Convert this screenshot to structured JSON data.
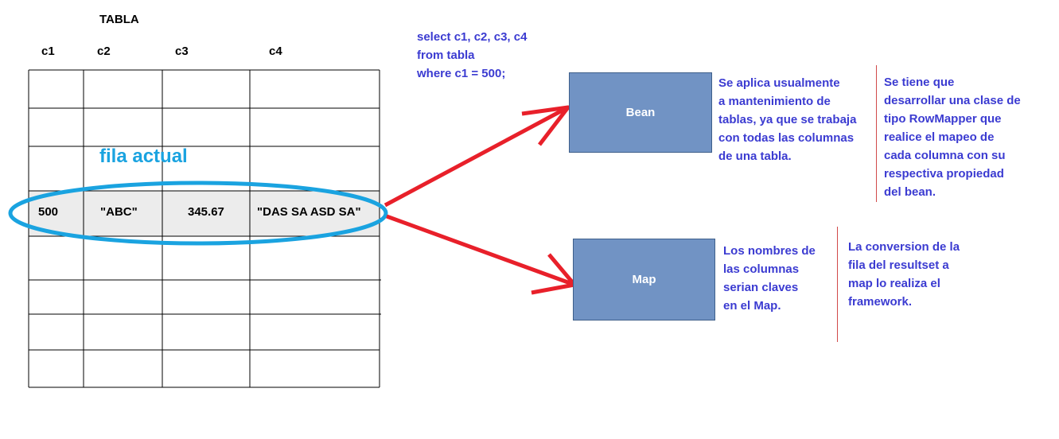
{
  "table": {
    "title": "TABLA",
    "columns": [
      "c1",
      "c2",
      "c3",
      "c4"
    ],
    "current_row": [
      "500",
      "\"ABC\"",
      "345.67",
      "\"DAS SA ASD SA\""
    ],
    "current_row_label": "fila actual"
  },
  "query": {
    "lines": [
      "select c1, c2, c3, c4",
      "from tabla",
      "where c1 = 500;"
    ]
  },
  "bean": {
    "label": "Bean",
    "note_lines": [
      "Se aplica usualmente",
      "a mantenimiento de",
      "tablas, ya que se trabaja",
      "con todas las columnas",
      "de una tabla."
    ],
    "detail_lines": [
      "Se tiene que",
      "desarrollar una clase de",
      "tipo RowMapper que",
      "realice el mapeo de",
      "cada columna con su",
      "respectiva propiedad",
      "del bean."
    ]
  },
  "map": {
    "label": "Map",
    "note_lines": [
      "Los nombres de",
      "las columnas",
      "serian claves",
      "en el Map."
    ],
    "detail_lines": [
      "La conversion de la",
      "fila del resultset a",
      "map lo realiza el",
      "framework."
    ]
  },
  "colors": {
    "text_blue": "#3b3bd1",
    "box_fill": "#7193c4",
    "ellipse": "#1aa3e0",
    "arrow": "#e8202a",
    "divider": "#d14a4a"
  }
}
